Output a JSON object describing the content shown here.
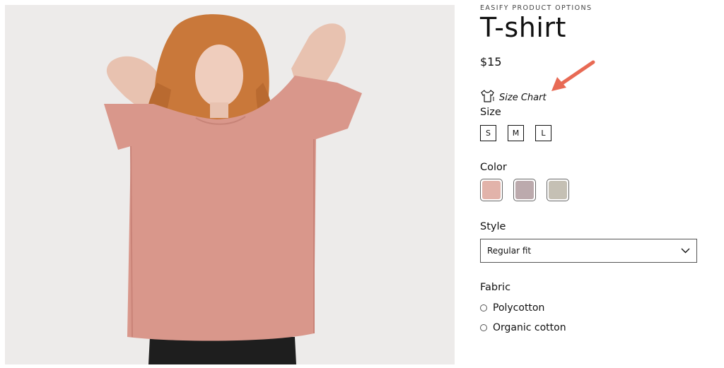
{
  "product": {
    "vendor": "EASIFY PRODUCT OPTIONS",
    "title": "T-shirt",
    "price": "$15"
  },
  "size_chart": {
    "label": "Size Chart",
    "icon": "shirt-icon"
  },
  "size": {
    "label": "Size",
    "options": [
      "S",
      "M",
      "L"
    ]
  },
  "color": {
    "label": "Color",
    "swatches": [
      "#e2b3aa",
      "#bcaaad",
      "#c5c0b4"
    ]
  },
  "style": {
    "label": "Style",
    "selected": "Regular fit",
    "icon": "chevron-down-icon"
  },
  "fabric": {
    "label": "Fabric",
    "options": [
      "Polycotton",
      "Organic cotton"
    ]
  },
  "colors": {
    "arrow": "#e86a54",
    "shirt": "#d9978b",
    "image_bg": "#edebea"
  }
}
